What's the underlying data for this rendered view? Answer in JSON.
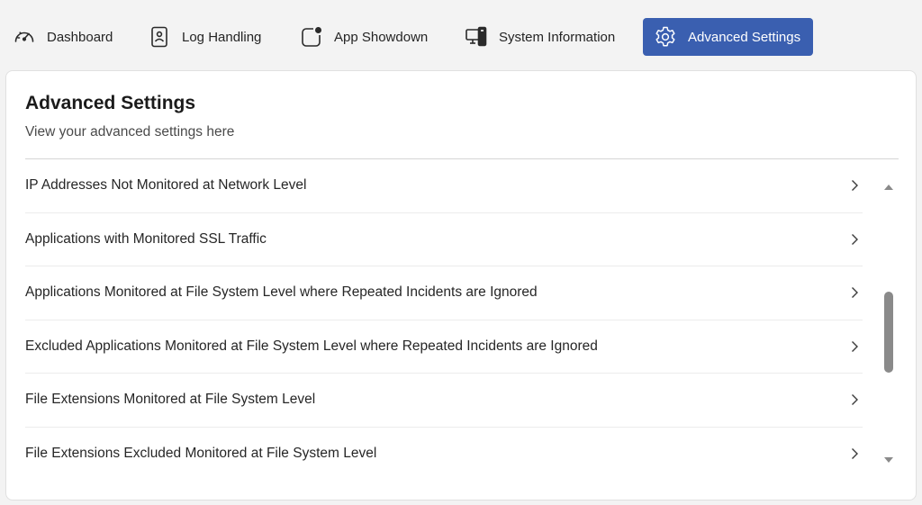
{
  "nav": {
    "tabs": [
      {
        "label": "Dashboard",
        "icon": "gauge-icon"
      },
      {
        "label": "Log Handling",
        "icon": "log-document-icon"
      },
      {
        "label": "App Showdown",
        "icon": "app-notification-icon"
      },
      {
        "label": "System Information",
        "icon": "computer-device-icon"
      },
      {
        "label": "Advanced Settings",
        "icon": "gear-icon",
        "active": true
      }
    ]
  },
  "colors": {
    "accent": "#3a5fb0",
    "background": "#f3f3f3",
    "card": "#ffffff"
  },
  "panel": {
    "title": "Advanced Settings",
    "subtitle": "View your advanced settings here",
    "items": [
      {
        "label": "IP Addresses Not Monitored at Network Level"
      },
      {
        "label": "Applications with Monitored SSL Traffic"
      },
      {
        "label": "Applications Monitored at File System Level where Repeated Incidents are Ignored"
      },
      {
        "label": "Excluded Applications Monitored at File System Level where Repeated Incidents are Ignored"
      },
      {
        "label": "File Extensions Monitored at File System Level"
      },
      {
        "label": "File Extensions Excluded Monitored at File System Level"
      }
    ]
  }
}
